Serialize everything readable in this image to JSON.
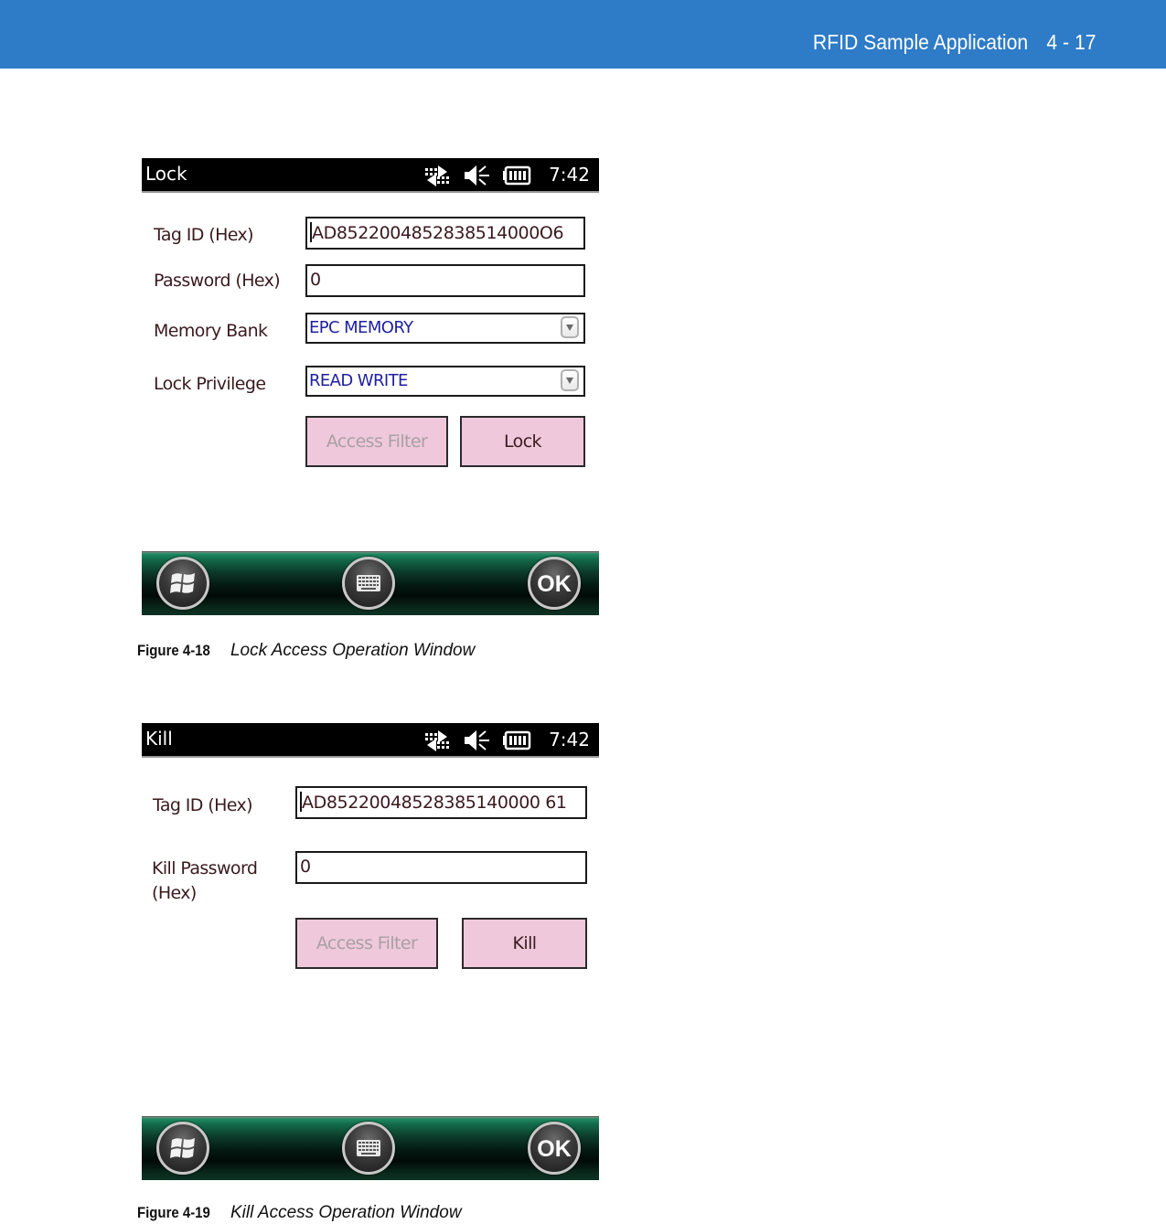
{
  "page_header": {
    "section_title": "RFID Sample Application",
    "page_number": "4 - 17",
    "background_color": "#2e7bc7"
  },
  "figures": [
    {
      "window": {
        "title": "Lock",
        "status_icons": [
          "connectivity-icon",
          "speaker-muted-icon",
          "battery-icon"
        ],
        "clock": "7:42",
        "fields": {
          "tag_id": {
            "label": "Tag ID (Hex)",
            "value": "AD8522004852838514000O6"
          },
          "password": {
            "label": "Password (Hex)",
            "value": "0"
          },
          "memory_bank": {
            "label": "Memory Bank",
            "selected": "EPC MEMORY"
          },
          "lock_privilege": {
            "label": "Lock Privilege",
            "selected": "READ WRITE"
          }
        },
        "buttons": {
          "access_filter": {
            "label": "Access Filter",
            "state": "disabled"
          },
          "action": {
            "label": "Lock",
            "state": "enabled"
          }
        },
        "softkeys": [
          "windows-start-icon",
          "keyboard-icon",
          "OK"
        ]
      },
      "caption": {
        "number": "Figure 4-18",
        "title": "Lock Access Operation Window"
      }
    },
    {
      "window": {
        "title": "Kill",
        "status_icons": [
          "connectivity-icon",
          "speaker-muted-icon",
          "battery-icon"
        ],
        "clock": "7:42",
        "fields": {
          "tag_id": {
            "label": "Tag ID (Hex)",
            "value": "AD85220048528385140000 61"
          },
          "kill_password": {
            "label_line1": "Kill Password",
            "label_line2": "(Hex)",
            "value": "0"
          }
        },
        "buttons": {
          "access_filter": {
            "label": "Access Filter",
            "state": "disabled"
          },
          "action": {
            "label": "Kill",
            "state": "enabled"
          }
        },
        "softkeys": [
          "windows-start-icon",
          "keyboard-icon",
          "OK"
        ]
      },
      "caption": {
        "number": "Figure 4-19",
        "title": "Kill Access Operation Window"
      }
    }
  ],
  "colors": {
    "button_fill": "#efc8db",
    "dropdown_text": "#2020a0",
    "label_text": "#3a1a1e",
    "softbar_green": "#136a4a"
  }
}
